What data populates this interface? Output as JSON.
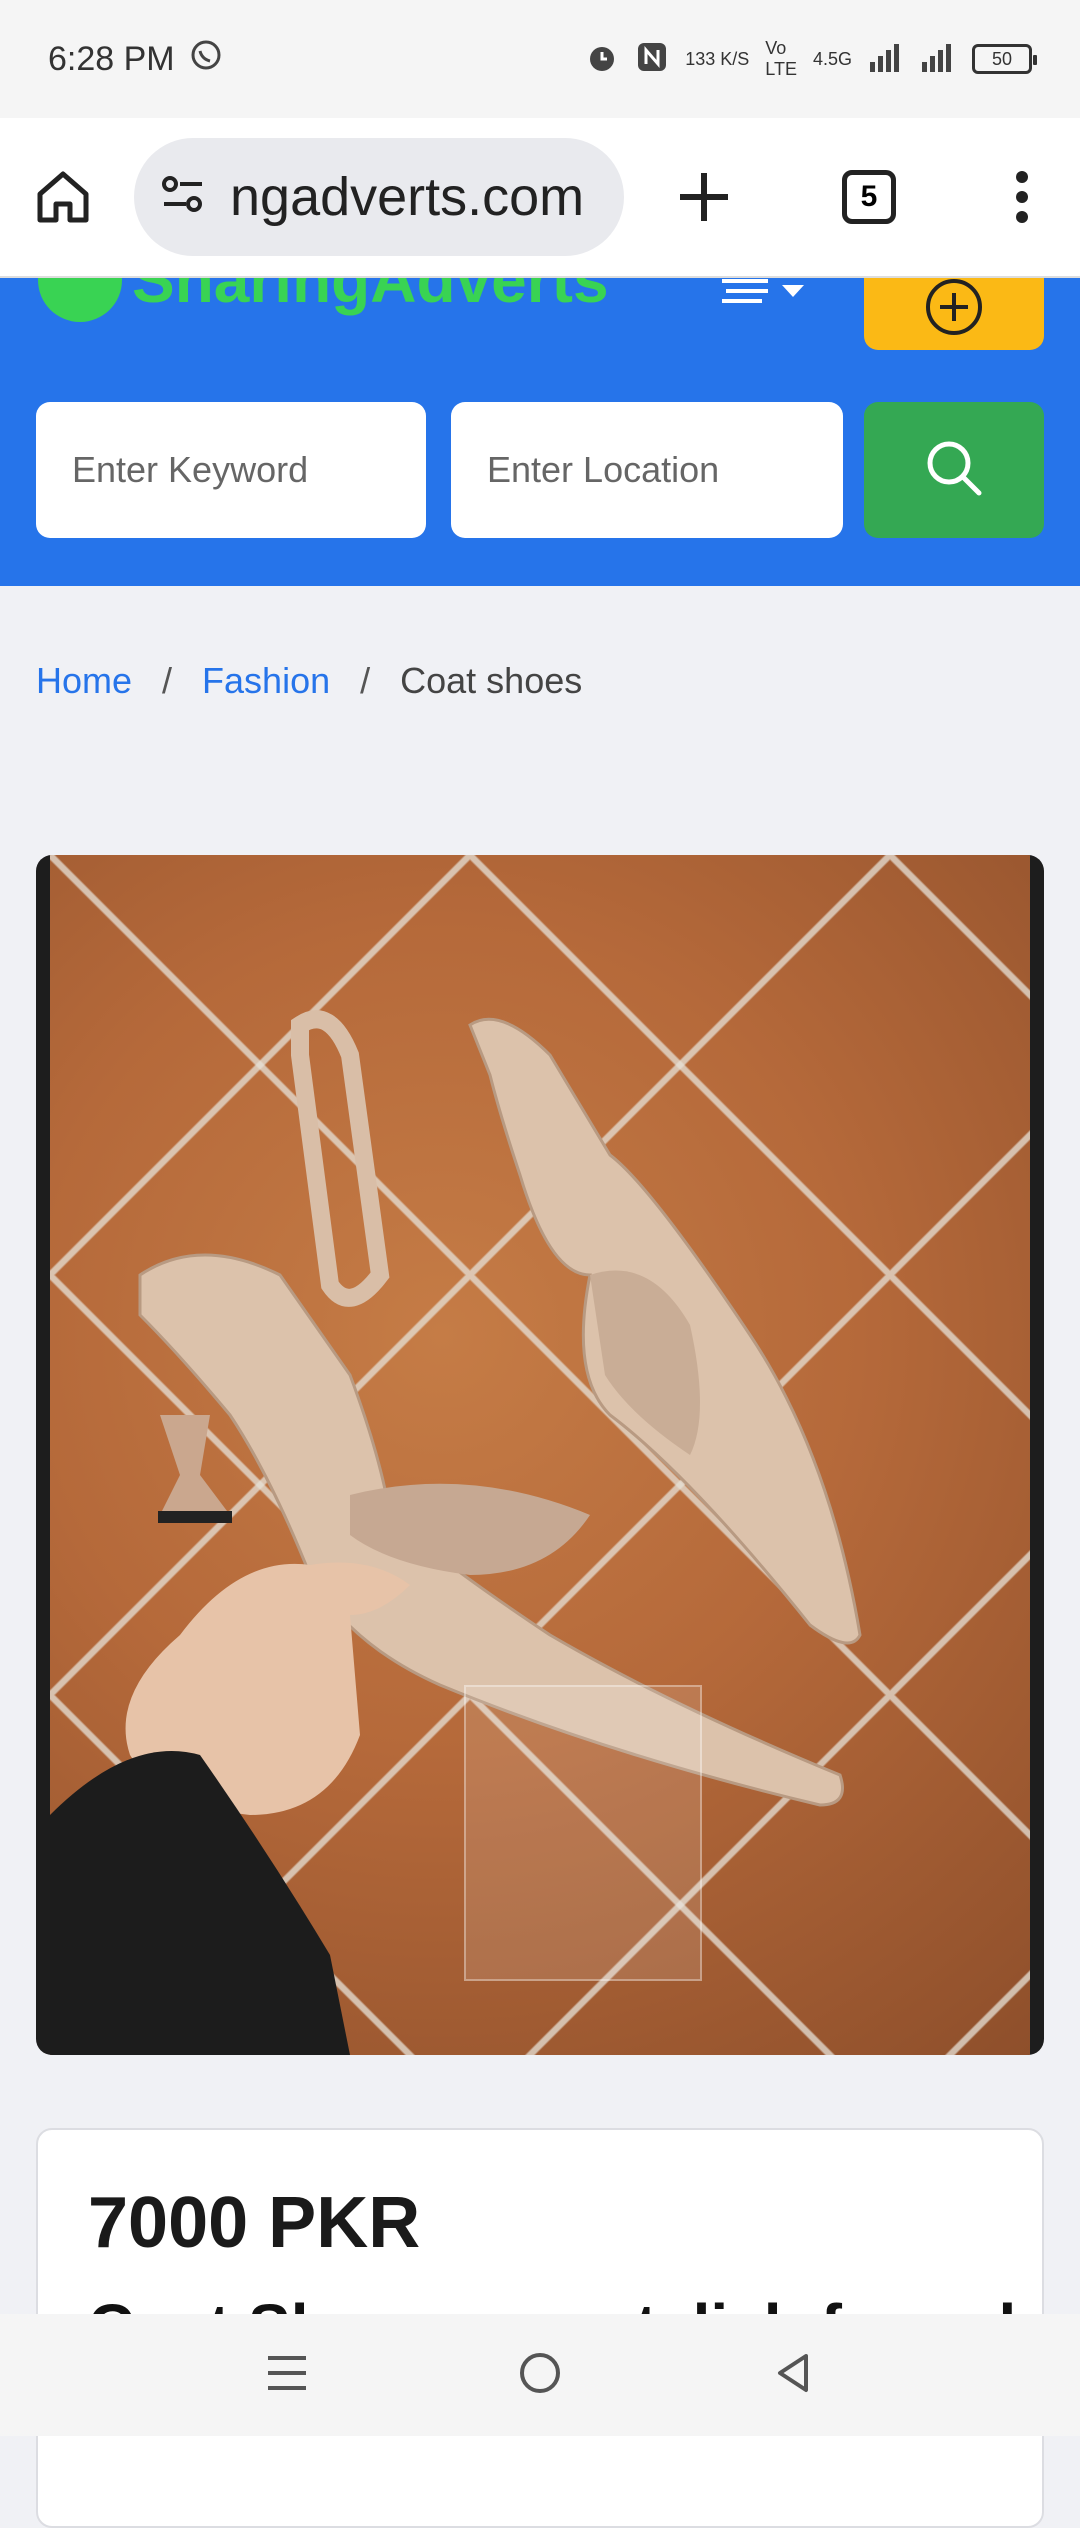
{
  "status_bar": {
    "time": "6:28 PM",
    "speed": "133 K/S",
    "network": "4.5G",
    "battery": "50"
  },
  "browser": {
    "url": "ngadverts.com",
    "tab_count": "5"
  },
  "site": {
    "logo_text_part1": "Sharing",
    "logo_text_part2": "Adverts",
    "keyword_placeholder": "Enter Keyword",
    "location_placeholder": "Enter Location"
  },
  "breadcrumb": {
    "home": "Home",
    "category": "Fashion",
    "current": "Coat shoes",
    "separator": "/"
  },
  "listing": {
    "price": "7000 PKR",
    "title": "Coat Shoes new stylish formal"
  },
  "colors": {
    "header_blue": "#2674ea",
    "logo_green": "#39d353",
    "post_yellow": "#fbb915",
    "search_green": "#34a853"
  }
}
